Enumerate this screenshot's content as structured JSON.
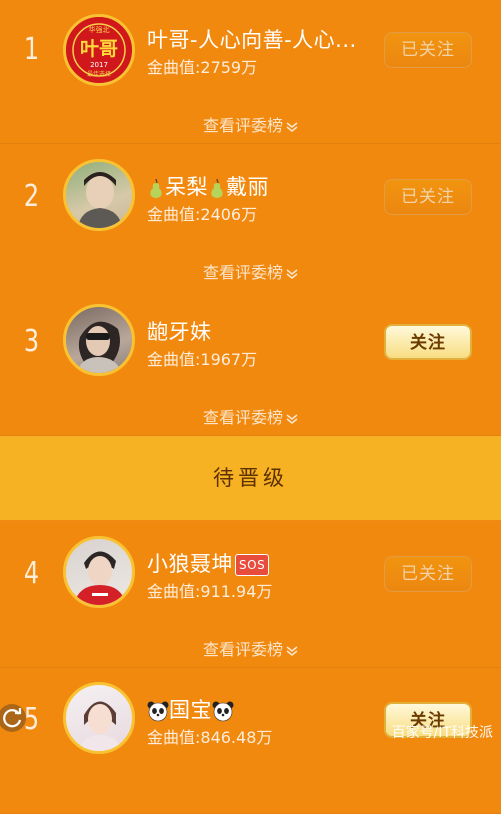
{
  "items": [
    {
      "rank": "1",
      "name": "叶哥-人心向善-人心...",
      "value": "金曲值:2759万",
      "button": "已关注",
      "review": "查看评委榜",
      "avatar_text_top": "华强北",
      "avatar_text_main": "叶哥",
      "avatar_text_year": "2017",
      "avatar_text_bottom": "最佳选择"
    },
    {
      "rank": "2",
      "name": "呆梨",
      "name2": "戴丽",
      "value": "金曲值:2406万",
      "button": "已关注",
      "review": "查看评委榜"
    },
    {
      "rank": "3",
      "name": "龅牙妹",
      "value": "金曲值:1967万",
      "button": "关注",
      "review": "查看评委榜"
    },
    {
      "rank": "4",
      "name": "小狼聂坤",
      "badge": "SOS",
      "value": "金曲值:911.94万",
      "button": "已关注",
      "review": "查看评委榜"
    },
    {
      "rank": "5",
      "name": "国宝",
      "value": "金曲值:846.48万",
      "button": "关注"
    }
  ],
  "divider": "待晋级",
  "watermark": "百家号/IT科技派",
  "colors": {
    "background": "#f2890f",
    "divider": "#f6b222",
    "follow_button": "#f8dd82"
  }
}
